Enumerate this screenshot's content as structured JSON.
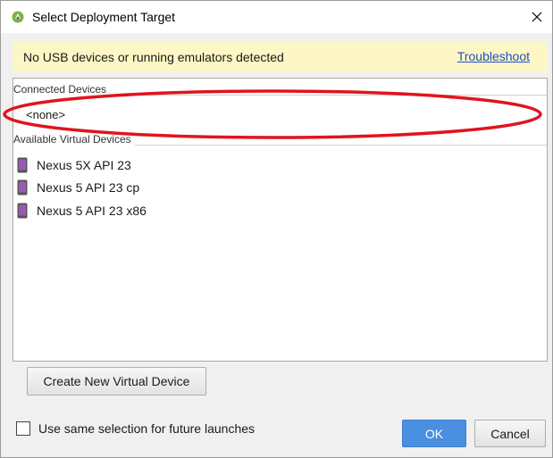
{
  "window": {
    "title": "Select Deployment Target"
  },
  "notice": {
    "message": "No USB devices or running emulators detected",
    "link": "Troubleshoot"
  },
  "connected": {
    "header": "Connected Devices",
    "empty_label": "<none>"
  },
  "available": {
    "header": "Available Virtual Devices",
    "devices": [
      {
        "label": "Nexus 5X API 23"
      },
      {
        "label": "Nexus 5 API 23 cp"
      },
      {
        "label": "Nexus 5 API 23 x86"
      }
    ]
  },
  "footer": {
    "create_button": "Create New Virtual Device",
    "checkbox_label": "Use same selection for future launches",
    "checkbox_checked": false,
    "ok_button": "OK",
    "cancel_button": "Cancel"
  },
  "colors": {
    "notice_bg": "#fcf7c5",
    "link": "#1f4fbf",
    "ok_button": "#4a8fe0",
    "annotation": "#e0141e",
    "phone_screen": "#9b59b6"
  }
}
